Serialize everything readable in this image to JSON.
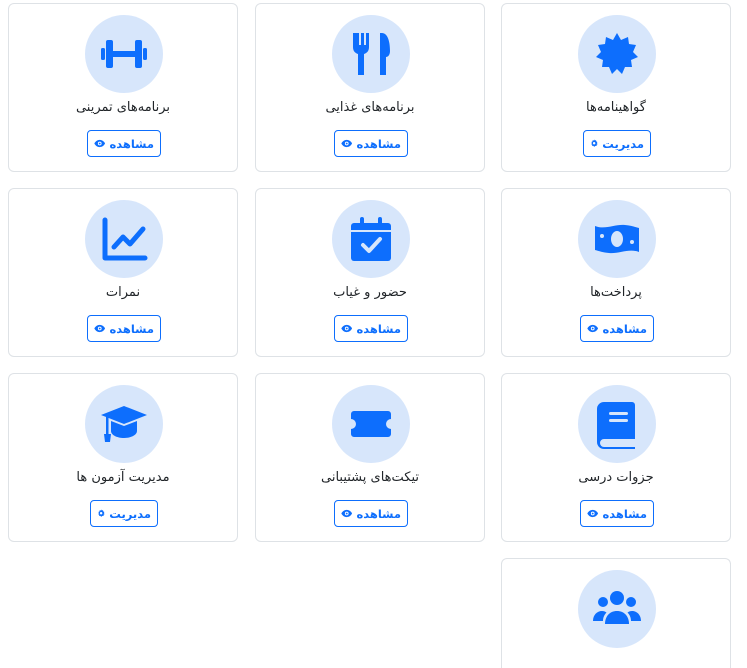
{
  "colors": {
    "accent": "#0d6efd",
    "circle_bg": "#d7e6fb",
    "border": "#dee2e6"
  },
  "cards": [
    {
      "title": "گواهینامه‌ها",
      "button": "مدیریت",
      "icon": "certificate-icon",
      "button_icon": "gear-icon"
    },
    {
      "title": "برنامه‌های غذایی",
      "button": "مشاهده",
      "icon": "utensils-icon",
      "button_icon": "eye-icon"
    },
    {
      "title": "برنامه‌های تمرینی",
      "button": "مشاهده",
      "icon": "dumbbell-icon",
      "button_icon": "eye-icon"
    },
    {
      "title": "پرداخت‌ها",
      "button": "مشاهده",
      "icon": "money-bill-icon",
      "button_icon": "eye-icon"
    },
    {
      "title": "حضور و غیاب",
      "button": "مشاهده",
      "icon": "calendar-check-icon",
      "button_icon": "eye-icon"
    },
    {
      "title": "نمرات",
      "button": "مشاهده",
      "icon": "chart-line-icon",
      "button_icon": "eye-icon"
    },
    {
      "title": "جزوات درسی",
      "button": "مشاهده",
      "icon": "book-icon",
      "button_icon": "eye-icon"
    },
    {
      "title": "تیکت‌های پشتیبانی",
      "button": "مشاهده",
      "icon": "ticket-icon",
      "button_icon": "eye-icon"
    },
    {
      "title": "مدیریت آزمون ها",
      "button": "مدیریت",
      "icon": "graduation-cap-icon",
      "button_icon": "gear-icon"
    },
    {
      "icon": "users-icon"
    }
  ]
}
